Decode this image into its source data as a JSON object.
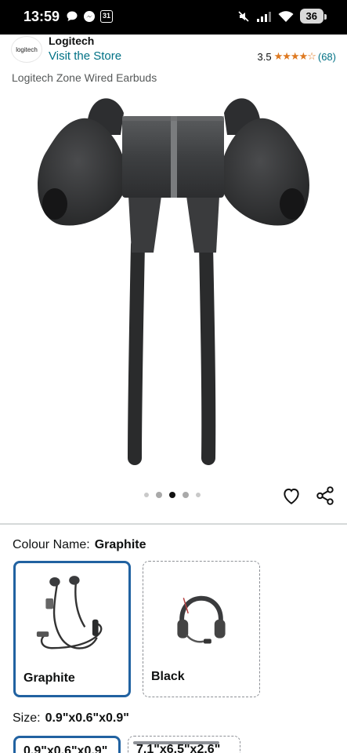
{
  "status_bar": {
    "time": "13:59",
    "calendar_day": "31",
    "battery": "36"
  },
  "brand": {
    "logo_text": "logitech",
    "name": "Logitech",
    "visit_store": "Visit the Store",
    "rating_value": "3.5",
    "rating_stars": "★★★★☆",
    "rating_count": "(68)"
  },
  "product": {
    "title": "Logitech Zone Wired Earbuds",
    "image_count": 5,
    "active_image_index": 2
  },
  "colour": {
    "label": "Colour Name:",
    "selected": "Graphite",
    "options": [
      {
        "label": "Graphite"
      },
      {
        "label": "Black"
      }
    ]
  },
  "size": {
    "label": "Size:",
    "selected": "0.9\"x0.6\"x0.9\"",
    "options": [
      {
        "label": "0.9\"x0.6\"x0.9\""
      },
      {
        "label": "7.1\"x6.5\"x2.6\""
      }
    ]
  },
  "colors": {
    "link": "#007185",
    "star": "#de7921",
    "selected_border": "#2162a1"
  }
}
